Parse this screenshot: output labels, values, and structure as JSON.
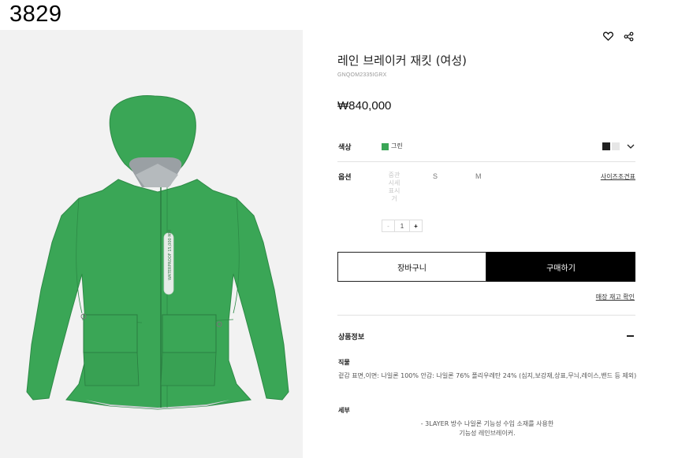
{
  "corner_label": "3829",
  "product": {
    "title": "레인 브레이커 재킷 (여성)",
    "sku": "GNQOM2335IGRX",
    "price": "₩840,000",
    "jacket_print": "WATERPROOF 15,000 MM"
  },
  "header_icons": [
    "heart-icon",
    "share-icon"
  ],
  "color": {
    "label": "색상",
    "selected": "그린",
    "selected_hex": "#3aa656",
    "swatches": [
      "#222222",
      "#e6e6e6"
    ]
  },
  "options": {
    "label": "옵션",
    "size_placeholder": "중관시세표시거",
    "sizes": [
      "S",
      "M"
    ],
    "size_guide": "사이즈조견표"
  },
  "quantity": {
    "minus": "-",
    "value": "1",
    "plus": "+"
  },
  "buttons": {
    "cart": "장바구니",
    "buy": "구매하기",
    "stock_check": "매장 재고 확인"
  },
  "info": {
    "title": "상품정보",
    "fabric_label": "직물",
    "fabric_text": "겉감 표면,이면: 나일론 100% 안감: 나일론 76% 폴리우레탄 24% (심지,보강재,상표,무늬,레이스,밴드 등 제외)",
    "detail_label": "세부",
    "detail_line1": "- 3LAYER 방수 나일론 기능성 수입 소재를 사용한",
    "detail_line2": "기능성 레인브레이커."
  }
}
